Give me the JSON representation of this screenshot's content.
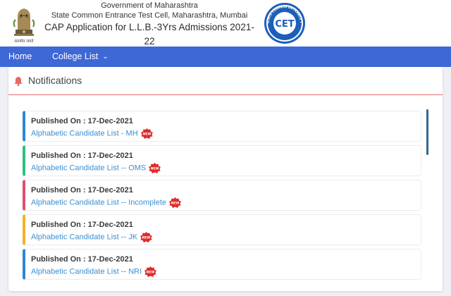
{
  "header": {
    "gov_line": "Government of Maharashtra",
    "cell_line": "State Common Entrance Test Cell, Maharashtra, Mumbai",
    "title": "CAP Application for L.L.B.-3Yrs Admissions 2021-22",
    "emblem_motto": "सत्यमेव जयते",
    "logo_text": "CET",
    "logo_ring_text": "STATE COMMON ENTRANCE TEST CELL · MAHARASHTRA"
  },
  "nav": {
    "home": "Home",
    "college_list": "College List"
  },
  "notifications": {
    "title": "Notifications",
    "new_badge": "NEW",
    "items": [
      {
        "published": "Published On : 17-Dec-2021",
        "link": "Alphabetic Candidate List - MH",
        "accent": "#2f86d6"
      },
      {
        "published": "Published On : 17-Dec-2021",
        "link": "Alphabetic Candidate List -- OMS",
        "accent": "#2fbf7a"
      },
      {
        "published": "Published On : 17-Dec-2021",
        "link": "Alphabetic Candidate List -- Incomplete",
        "accent": "#e0506b"
      },
      {
        "published": "Published On : 17-Dec-2021",
        "link": "Alphabetic Candidate List -- JK",
        "accent": "#f2b32a"
      },
      {
        "published": "Published On : 17-Dec-2021",
        "link": "Alphabetic Candidate List -- NRI",
        "accent": "#2f86d6"
      }
    ]
  },
  "colors": {
    "navbar": "#3d68d6",
    "heading_rule": "#e56a6a",
    "link": "#3b8fd1",
    "badge": "#e02a2a"
  }
}
